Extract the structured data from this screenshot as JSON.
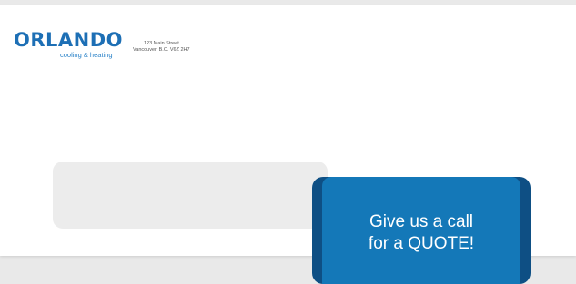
{
  "logo": {
    "wordmark": "ORLANDO",
    "tagline": "cooling & heating",
    "brand_color": "#1d6fb5",
    "accent_color": "#2a82c8"
  },
  "address": {
    "line1": "123 Main Street",
    "line2": "Vancouver, B.C. V6Z 2H7"
  },
  "cta": {
    "line1": "Give us a call",
    "line2": "for a QUOTE!",
    "color_front": "#1478b8",
    "color_back": "#0e4f84"
  }
}
